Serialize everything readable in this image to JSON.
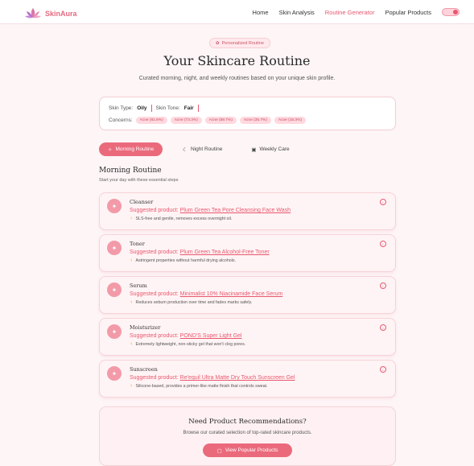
{
  "header": {
    "brand": "SkinAura",
    "nav": [
      {
        "label": "Home",
        "active": false
      },
      {
        "label": "Skin Analysis",
        "active": false
      },
      {
        "label": "Routine Generator",
        "active": true
      },
      {
        "label": "Popular Products",
        "active": false
      }
    ]
  },
  "hero": {
    "badge": "Personalized Routine",
    "title": "Your Skincare Routine",
    "subtitle": "Curated morning, night, and weekly routines based on your unique skin profile."
  },
  "profile": {
    "skin_type_label": "Skin Type:",
    "skin_type_value": "Oily",
    "skin_tone_label": "Skin Tone:",
    "skin_tone_value": "Fair",
    "concerns_label": "Concerns:",
    "concerns": [
      "Acne (81.8%)",
      "Acne (73.3%)",
      "Acne (58.7%)",
      "Acne (35.7%)",
      "Acne (15.3%)"
    ]
  },
  "tabs": [
    {
      "label": "Morning Routine",
      "active": true,
      "icon": "sun-icon"
    },
    {
      "label": "Night Routine",
      "active": false,
      "icon": "moon-icon"
    },
    {
      "label": "Weekly Care",
      "active": false,
      "icon": "calendar-icon"
    }
  ],
  "section": {
    "title": "Morning Routine",
    "subtitle": "Start your day with these essential steps"
  },
  "steps": [
    {
      "name": "Cleanser",
      "prefix": "Suggested product:",
      "product": "Plum Green Tea Pore Cleansing Face Wash",
      "tip": "SLS-free and gentle, removes excess overnight oil."
    },
    {
      "name": "Toner",
      "prefix": "Suggested product:",
      "product": "Plum Green Tea Alcohol-Free Toner",
      "tip": "Astringent properties without harmful drying alcohols."
    },
    {
      "name": "Serum",
      "prefix": "Suggested product:",
      "product": "Minimalist 10% Niacinamide Face Serum",
      "tip": "Reduces sebum production over time and fades marks safely."
    },
    {
      "name": "Moisturizer",
      "prefix": "Suggested product:",
      "product": "POND'S Super Light Gel",
      "tip": "Extremely lightweight, non-sticky gel that won't clog pores."
    },
    {
      "name": "Sunscreen",
      "prefix": "Suggested product:",
      "product": "Re'equil Ultra Matte Dry Touch Sunscreen Gel",
      "tip": "Silicone-based, provides a primer-like matte finish that controls sweat."
    }
  ],
  "reco": {
    "title": "Need Product Recommendations?",
    "subtitle": "Browse our curated selection of top-rated skincare products.",
    "button": "View Popular Products"
  },
  "colors": {
    "accent": "#ea6a7c",
    "brand": "#e46a7f",
    "background": "#fdf5f6"
  }
}
